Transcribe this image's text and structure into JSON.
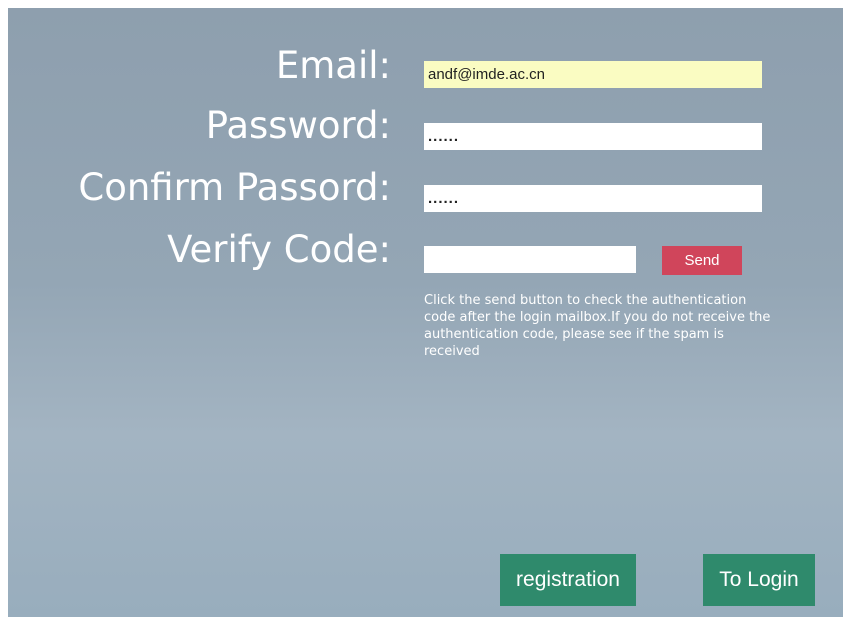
{
  "form": {
    "email_label": "Email:",
    "password_label": "Password:",
    "confirm_label": "Confirm Passord:",
    "verify_label": "Verify Code:",
    "email_value": "andf@imde.ac.cn",
    "password_value": "......",
    "confirm_value": "......",
    "verify_value": "",
    "send_label": "Send",
    "hint": "Click the send button to check the authentication code after the login mailbox.If you do not receive the authentication code, please see if the spam is received"
  },
  "actions": {
    "registration_label": "registration",
    "login_label": "To Login"
  },
  "colors": {
    "send_button": "#d0455b",
    "action_button": "#2f8a6c",
    "autofill_background": "#fafcc2"
  }
}
